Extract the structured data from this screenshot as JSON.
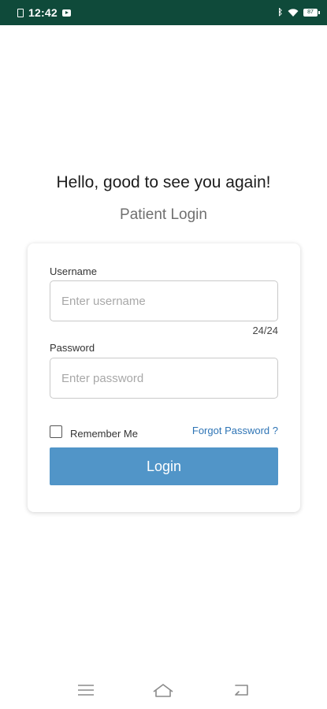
{
  "status_bar": {
    "time": "12:42",
    "battery_level": "87",
    "icons": [
      "sim-icon",
      "youtube-icon",
      "bluetooth-icon",
      "wifi-icon",
      "battery-icon"
    ]
  },
  "header": {
    "greeting": "Hello, good to see you again!",
    "subtitle": "Patient Login"
  },
  "login_form": {
    "username_label": "Username",
    "username_placeholder": "Enter username",
    "username_value": "",
    "username_counter": "24/24",
    "password_label": "Password",
    "password_placeholder": "Enter password",
    "password_value": "",
    "remember_label": "Remember Me",
    "remember_checked": false,
    "forgot_label": "Forgot Password ?",
    "login_label": "Login"
  },
  "nav_bar": {
    "icons": [
      "menu-icon",
      "home-icon",
      "back-icon"
    ]
  },
  "colors": {
    "status_bar": "#0f4a3a",
    "primary_button": "#5195c8",
    "link": "#2e74b5"
  }
}
